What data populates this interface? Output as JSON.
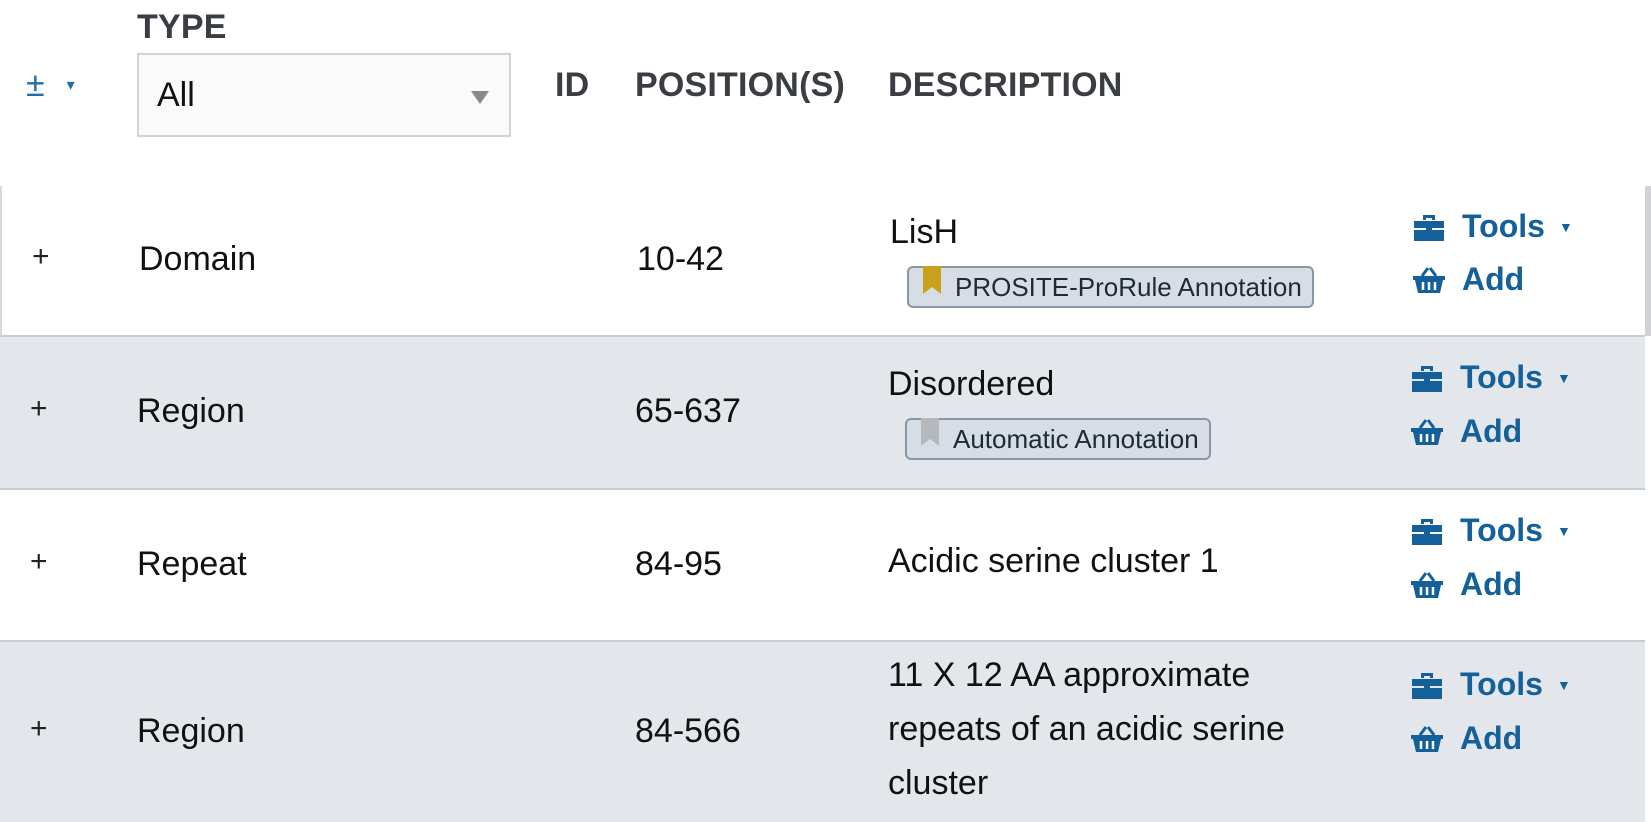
{
  "header": {
    "expand_symbol": "±",
    "expand_caret": "▾",
    "type_label": "TYPE",
    "type_select_value": "All",
    "col_id": "ID",
    "col_positions": "POSITION(S)",
    "col_description": "DESCRIPTION"
  },
  "rows": [
    {
      "expand": "+",
      "type": "Domain",
      "positions": "10-42",
      "description": "LisH",
      "badge": {
        "label": "PROSITE-ProRule Annotation",
        "ribbon_color": "#c9a11c"
      },
      "tools_label": "Tools",
      "add_label": "Add"
    },
    {
      "expand": "+",
      "type": "Region",
      "positions": "65-637",
      "description": "Disordered",
      "badge": {
        "label": "Automatic Annotation",
        "ribbon_color": "#b5b8bc"
      },
      "tools_label": "Tools",
      "add_label": "Add"
    },
    {
      "expand": "+",
      "type": "Repeat",
      "positions": "84-95",
      "description": "Acidic serine cluster 1",
      "tools_label": "Tools",
      "add_label": "Add"
    },
    {
      "expand": "+",
      "type": "Region",
      "positions": "84-566",
      "description_lines": [
        "11 X 12 AA approximate",
        "repeats of an acidic serine",
        "cluster"
      ],
      "tools_label": "Tools",
      "add_label": "Add"
    }
  ],
  "colors": {
    "link": "#14609a",
    "alt_row": "#e3e7eb",
    "header_text": "#3a3d42"
  },
  "icons": {
    "tools": "toolbox-icon",
    "add": "basket-icon",
    "dropdown": "triangle-down-icon"
  }
}
